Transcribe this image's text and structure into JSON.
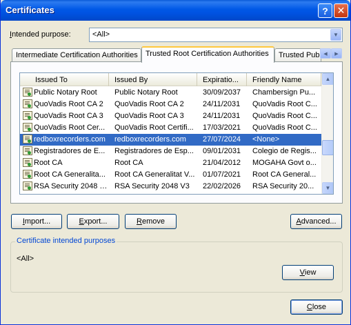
{
  "window": {
    "title": "Certificates"
  },
  "title_buttons": {
    "help": "?",
    "close": "✕"
  },
  "purpose": {
    "label_prefix": "I",
    "label_rest": "ntended purpose:",
    "value": "<All>"
  },
  "tabs": [
    {
      "label": "Intermediate Certification Authorities",
      "active": false
    },
    {
      "label": "Trusted Root Certification Authorities",
      "active": true
    },
    {
      "label": "Trusted Publ",
      "active": false
    }
  ],
  "columns": [
    "Issued To",
    "Issued By",
    "Expiratio...",
    "Friendly Name"
  ],
  "rows": [
    {
      "issued_to": "Public Notary Root",
      "issued_by": "Public Notary Root",
      "expiration": "30/09/2037",
      "friendly": "Chambersign Pu..."
    },
    {
      "issued_to": "QuoVadis Root CA 2",
      "issued_by": "QuoVadis Root CA 2",
      "expiration": "24/11/2031",
      "friendly": "QuoVadis Root C..."
    },
    {
      "issued_to": "QuoVadis Root CA 3",
      "issued_by": "QuoVadis Root CA 3",
      "expiration": "24/11/2031",
      "friendly": "QuoVadis Root C..."
    },
    {
      "issued_to": "QuoVadis Root Cer...",
      "issued_by": "QuoVadis Root Certifi...",
      "expiration": "17/03/2021",
      "friendly": "QuoVadis Root C..."
    },
    {
      "issued_to": "redboxrecorders.com",
      "issued_by": "redboxrecorders.com",
      "expiration": "27/07/2024",
      "friendly": "<None>",
      "selected": true
    },
    {
      "issued_to": "Registradores de E...",
      "issued_by": "Registradores de Esp...",
      "expiration": "09/01/2031",
      "friendly": "Colegio de Regis..."
    },
    {
      "issued_to": "Root CA",
      "issued_by": "Root CA",
      "expiration": "21/04/2012",
      "friendly": "MOGAHA Govt o..."
    },
    {
      "issued_to": "Root CA Generalita...",
      "issued_by": "Root CA Generalitat V...",
      "expiration": "01/07/2021",
      "friendly": "Root CA General..."
    },
    {
      "issued_to": "RSA Security 2048 V3",
      "issued_by": "RSA Security 2048 V3",
      "expiration": "22/02/2026",
      "friendly": "RSA Security 20..."
    }
  ],
  "buttons": {
    "import": {
      "u": "I",
      "rest": "mport..."
    },
    "export": {
      "u": "E",
      "rest": "xport..."
    },
    "remove": {
      "u": "R",
      "rest": "emove"
    },
    "advanced": {
      "u": "A",
      "rest": "dvanced..."
    },
    "view": {
      "u": "V",
      "rest": "iew"
    },
    "close": {
      "u": "C",
      "rest": "lose"
    }
  },
  "purposes_group": {
    "title": "Certificate intended purposes",
    "value": "<All>"
  },
  "icons": {
    "dropdown": "chevron-down-icon",
    "tab_left": "arrow-left-icon",
    "tab_right": "arrow-right-icon",
    "scroll_up": "arrow-up-icon",
    "scroll_down": "arrow-down-icon",
    "cert": "certificate-icon"
  }
}
